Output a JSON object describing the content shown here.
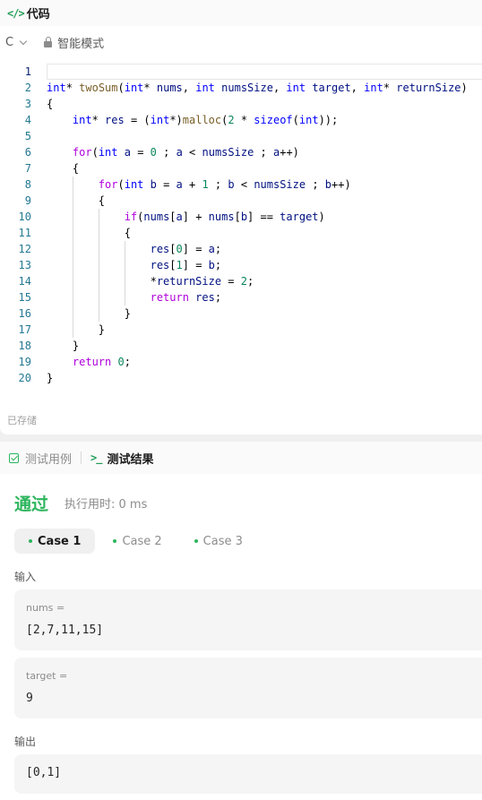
{
  "code_panel": {
    "tab_label": "代码",
    "tab_icon": "</>",
    "language": "C",
    "mode_label": "智能模式",
    "saved_status": "已存储"
  },
  "result_panel": {
    "testcase_tab": "测试用例",
    "result_tab_icon": ">_",
    "result_tab": "测试结果",
    "status": "通过",
    "runtime": "执行用时: 0 ms",
    "cases": [
      "Case 1",
      "Case 2",
      "Case 3"
    ],
    "input_label": "输入",
    "inputs": [
      {
        "name": "nums =",
        "value": "[2,7,11,15]"
      },
      {
        "name": "target =",
        "value": "9"
      }
    ],
    "output_label": "输出",
    "output_value": "[0,1]"
  },
  "code_lines": [
    {
      "n": "1",
      "tokens": []
    },
    {
      "n": "2",
      "tokens": [
        [
          "kw",
          "int"
        ],
        [
          "",
          "* "
        ],
        [
          "fn",
          "twoSum"
        ],
        [
          "",
          "("
        ],
        [
          "kw",
          "int"
        ],
        [
          "",
          "* "
        ],
        [
          "var",
          "nums"
        ],
        [
          "",
          ", "
        ],
        [
          "kw",
          "int"
        ],
        [
          "",
          ""
        ],
        [
          "var",
          " numsSize"
        ],
        [
          "",
          ", "
        ],
        [
          "kw",
          "int"
        ],
        [
          "var",
          " target"
        ],
        [
          "",
          ", "
        ],
        [
          "kw",
          "int"
        ],
        [
          "",
          "* "
        ],
        [
          "var",
          "returnSize"
        ],
        [
          "",
          ")"
        ]
      ]
    },
    {
      "n": "3",
      "tokens": [
        [
          "",
          "{"
        ]
      ]
    },
    {
      "n": "4",
      "tokens": [
        [
          "",
          "    "
        ],
        [
          "kw",
          "int"
        ],
        [
          "",
          "* "
        ],
        [
          "var",
          "res"
        ],
        [
          "",
          " = ("
        ],
        [
          "kw",
          "int"
        ],
        [
          "",
          "*)"
        ],
        [
          "fn",
          "malloc"
        ],
        [
          "",
          "("
        ],
        [
          "num",
          "2"
        ],
        [
          "",
          " * "
        ],
        [
          "kw",
          "sizeof"
        ],
        [
          "",
          "("
        ],
        [
          "kw",
          "int"
        ],
        [
          "",
          "));"
        ]
      ]
    },
    {
      "n": "5",
      "tokens": []
    },
    {
      "n": "6",
      "tokens": [
        [
          "",
          "    "
        ],
        [
          "ctl",
          "for"
        ],
        [
          "",
          "("
        ],
        [
          "kw",
          "int"
        ],
        [
          "var",
          " a"
        ],
        [
          "",
          " = "
        ],
        [
          "num",
          "0"
        ],
        [
          "",
          " ; "
        ],
        [
          "var",
          "a"
        ],
        [
          "",
          " < "
        ],
        [
          "var",
          "numsSize"
        ],
        [
          "",
          " ; "
        ],
        [
          "var",
          "a"
        ],
        [
          "",
          "++)"
        ]
      ]
    },
    {
      "n": "7",
      "tokens": [
        [
          "",
          "    {"
        ]
      ]
    },
    {
      "n": "8",
      "tokens": [
        [
          "",
          "        "
        ],
        [
          "ctl",
          "for"
        ],
        [
          "",
          "("
        ],
        [
          "kw",
          "int"
        ],
        [
          "var",
          " b"
        ],
        [
          "",
          " = "
        ],
        [
          "var",
          "a"
        ],
        [
          "",
          " + "
        ],
        [
          "num",
          "1"
        ],
        [
          "",
          " ; "
        ],
        [
          "var",
          "b"
        ],
        [
          "",
          " < "
        ],
        [
          "var",
          "numsSize"
        ],
        [
          "",
          " ; "
        ],
        [
          "var",
          "b"
        ],
        [
          "",
          "++)"
        ]
      ]
    },
    {
      "n": "9",
      "tokens": [
        [
          "",
          "        {"
        ]
      ]
    },
    {
      "n": "10",
      "tokens": [
        [
          "",
          "            "
        ],
        [
          "ctl",
          "if"
        ],
        [
          "",
          "("
        ],
        [
          "var",
          "nums"
        ],
        [
          "",
          "["
        ],
        [
          "var",
          "a"
        ],
        [
          "",
          "] + "
        ],
        [
          "var",
          "nums"
        ],
        [
          "",
          "["
        ],
        [
          "var",
          "b"
        ],
        [
          "",
          "] == "
        ],
        [
          "var",
          "target"
        ],
        [
          "",
          ")"
        ]
      ]
    },
    {
      "n": "11",
      "tokens": [
        [
          "",
          "            {"
        ]
      ]
    },
    {
      "n": "12",
      "tokens": [
        [
          "",
          "                "
        ],
        [
          "var",
          "res"
        ],
        [
          "",
          "["
        ],
        [
          "num",
          "0"
        ],
        [
          "",
          "] = "
        ],
        [
          "var",
          "a"
        ],
        [
          "",
          ";"
        ]
      ]
    },
    {
      "n": "13",
      "tokens": [
        [
          "",
          "                "
        ],
        [
          "var",
          "res"
        ],
        [
          "",
          "["
        ],
        [
          "num",
          "1"
        ],
        [
          "",
          "] = "
        ],
        [
          "var",
          "b"
        ],
        [
          "",
          ";"
        ]
      ]
    },
    {
      "n": "14",
      "tokens": [
        [
          "",
          "                *"
        ],
        [
          "var",
          "returnSize"
        ],
        [
          "",
          " = "
        ],
        [
          "num",
          "2"
        ],
        [
          "",
          ";"
        ]
      ]
    },
    {
      "n": "15",
      "tokens": [
        [
          "",
          "                "
        ],
        [
          "ctl",
          "return"
        ],
        [
          "var",
          " res"
        ],
        [
          "",
          ";"
        ]
      ]
    },
    {
      "n": "16",
      "tokens": [
        [
          "",
          "            }"
        ]
      ]
    },
    {
      "n": "17",
      "tokens": [
        [
          "",
          "        }"
        ]
      ]
    },
    {
      "n": "18",
      "tokens": [
        [
          "",
          "    }"
        ]
      ]
    },
    {
      "n": "19",
      "tokens": [
        [
          "",
          "    "
        ],
        [
          "ctl",
          "return"
        ],
        [
          "",
          ""
        ],
        [
          "num",
          " 0"
        ],
        [
          "",
          ";"
        ]
      ]
    },
    {
      "n": "20",
      "tokens": [
        [
          "",
          "}"
        ]
      ]
    }
  ]
}
